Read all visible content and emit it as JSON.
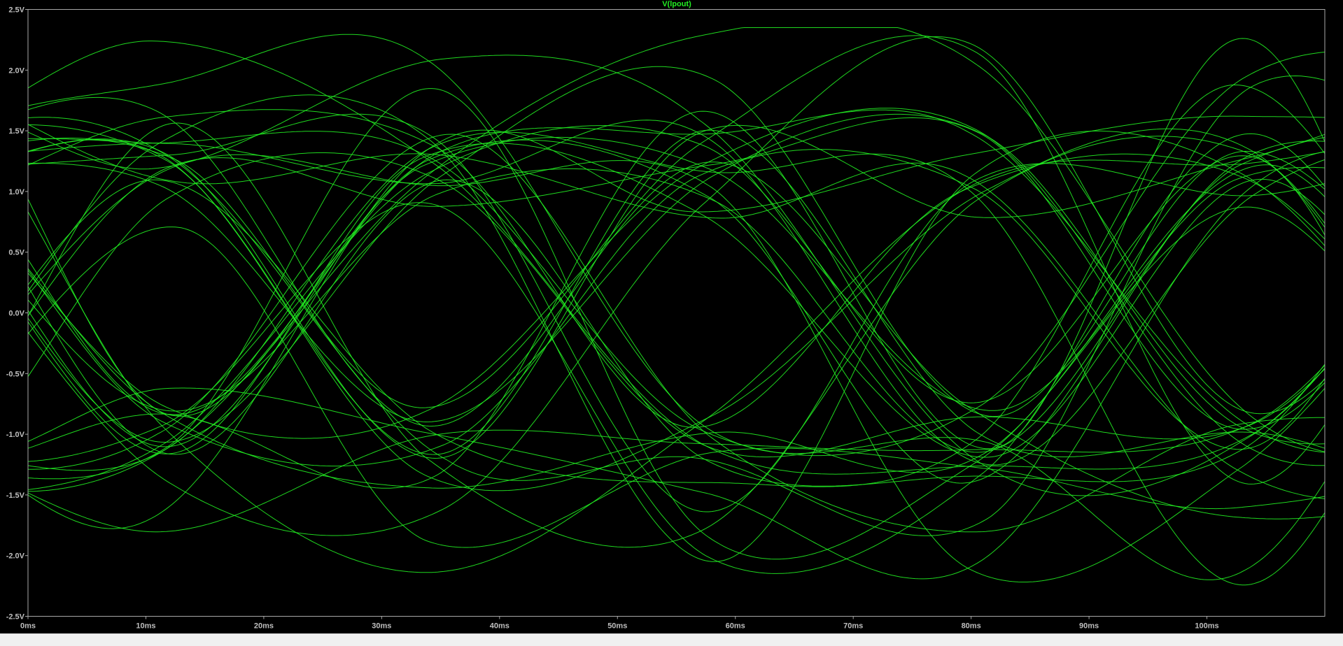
{
  "chart_data": {
    "type": "line",
    "title": "V(lpout)",
    "xlabel": "",
    "ylabel": "",
    "xlim": [
      0,
      110
    ],
    "ylim": [
      -2.5,
      2.5
    ],
    "x_unit": "ms",
    "y_unit": "V",
    "x_ticks": [
      {
        "value": 0,
        "label": "0ms"
      },
      {
        "value": 10,
        "label": "10ms"
      },
      {
        "value": 20,
        "label": "20ms"
      },
      {
        "value": 30,
        "label": "30ms"
      },
      {
        "value": 40,
        "label": "40ms"
      },
      {
        "value": 50,
        "label": "50ms"
      },
      {
        "value": 60,
        "label": "60ms"
      },
      {
        "value": 70,
        "label": "70ms"
      },
      {
        "value": 80,
        "label": "80ms"
      },
      {
        "value": 90,
        "label": "90ms"
      },
      {
        "value": 100,
        "label": "100ms"
      }
    ],
    "y_ticks": [
      {
        "value": 2.5,
        "label": "2.5V"
      },
      {
        "value": 2.0,
        "label": "2.0V"
      },
      {
        "value": 1.5,
        "label": "1.5V"
      },
      {
        "value": 1.0,
        "label": "1.0V"
      },
      {
        "value": 0.5,
        "label": "0.5V"
      },
      {
        "value": 0.0,
        "label": "0.0V"
      },
      {
        "value": -0.5,
        "label": "-0.5V"
      },
      {
        "value": -1.0,
        "label": "-1.0V"
      },
      {
        "value": -1.5,
        "label": "-1.5V"
      },
      {
        "value": -2.0,
        "label": "-2.0V"
      },
      {
        "value": -2.5,
        "label": "-2.5V"
      }
    ],
    "grid": false,
    "eye_pattern": {
      "trace_count": 44,
      "crossing_times_ms": [
        0,
        23,
        45,
        67,
        89
      ],
      "crossing_level_v": 0.05,
      "high_level_v": 1.2,
      "low_level_v": -1.1,
      "overshoot_max_v": 2.3,
      "undershoot_min_v": -2.25
    },
    "colors": {
      "background": "#000000",
      "trace": "#22ee22",
      "title": "#22ee22",
      "axis": "#a8a8a8",
      "tick_label": "#bfbfbf"
    }
  }
}
